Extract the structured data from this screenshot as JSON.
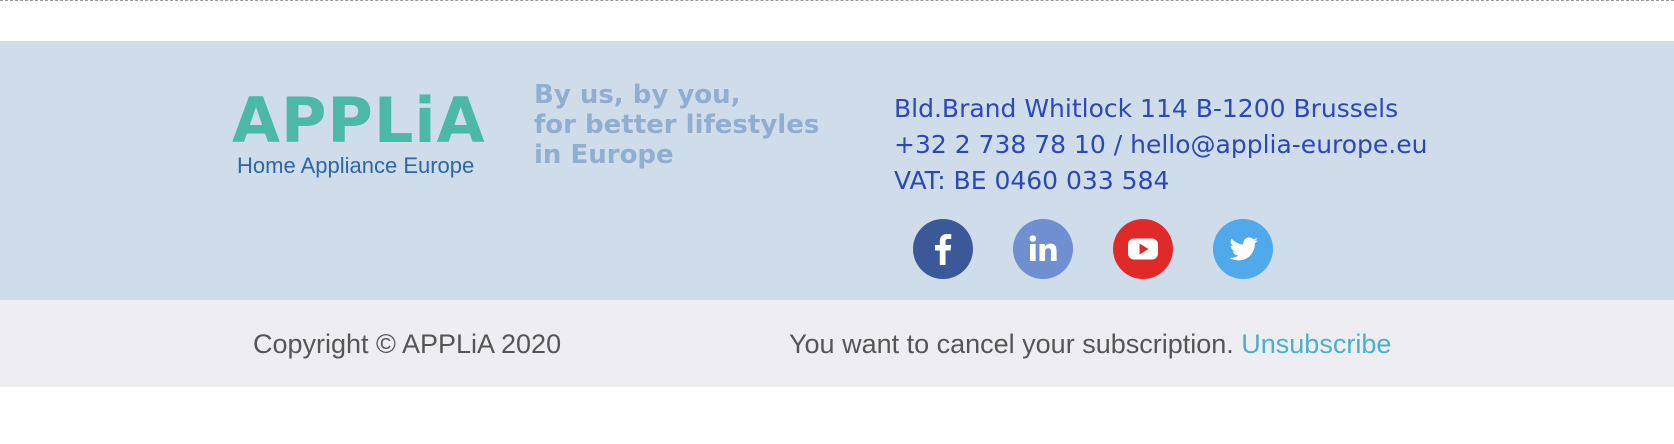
{
  "logo": {
    "wordmark": "APPLiA",
    "subtitle": "Home Appliance Europe",
    "brand_color": "#4cb8a6",
    "subtitle_color": "#2f66a8"
  },
  "tagline": {
    "lines": [
      "By us, by you,",
      "for better lifestyles",
      "in Europe"
    ],
    "color": "#90aecf"
  },
  "contact": {
    "address": "Bld.Brand Whitlock 114 B-1200 Brussels",
    "phone_email": "+32 2 738 78 10 / hello@applia-europe.eu",
    "vat": "VAT: BE 0460 033 584",
    "color": "#2c47b8"
  },
  "social": [
    {
      "name": "facebook-icon",
      "color": "#3b5998"
    },
    {
      "name": "linkedin-icon",
      "color": "#6f8fd0"
    },
    {
      "name": "youtube-icon",
      "color": "#e02a2a"
    },
    {
      "name": "twitter-icon",
      "color": "#4fa9ea"
    }
  ],
  "footer": {
    "copyright": "Copyright © APPLiA 2020",
    "cancel_text": "You want to cancel your subscription.",
    "unsubscribe_label": "Unsubscribe",
    "link_color": "#49b0c9"
  }
}
